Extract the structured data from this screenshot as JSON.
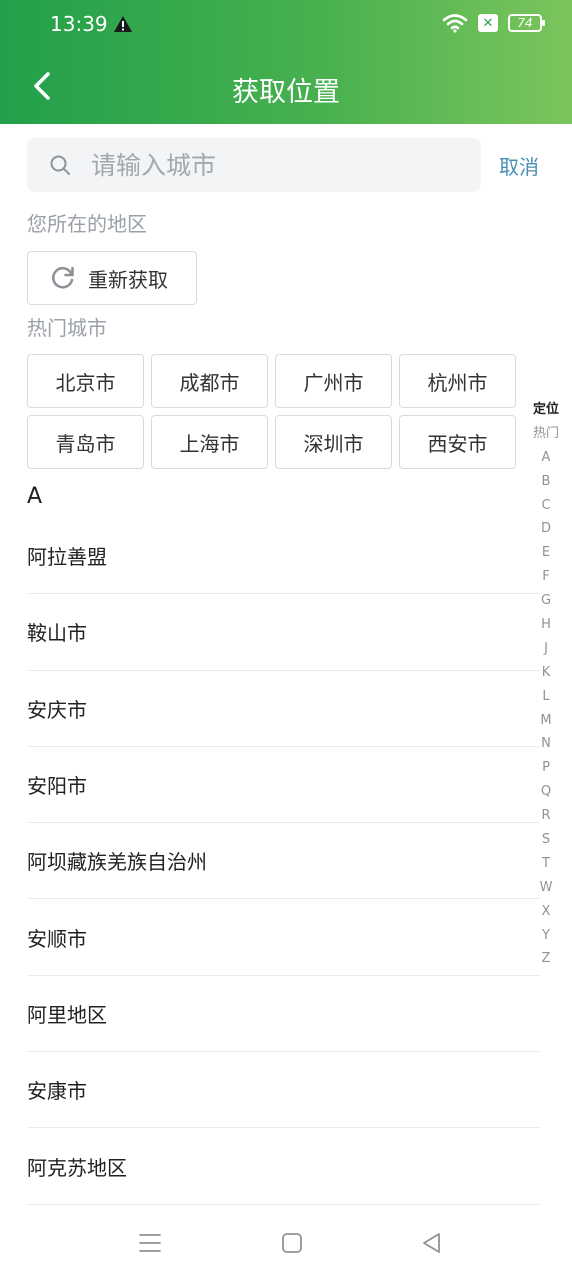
{
  "status_bar": {
    "time": "13:39",
    "battery": "74"
  },
  "header": {
    "title": "获取位置"
  },
  "search": {
    "placeholder": "请输入城市",
    "value": "",
    "cancel_label": "取消"
  },
  "location": {
    "section_label": "您所在的地区",
    "relocate_label": "重新获取"
  },
  "hot": {
    "section_label": "热门城市",
    "cities": [
      "北京市",
      "成都市",
      "广州市",
      "杭州市",
      "青岛市",
      "上海市",
      "深圳市",
      "西安市"
    ]
  },
  "list": {
    "letter": "A",
    "cities": [
      "阿拉善盟",
      "鞍山市",
      "安庆市",
      "安阳市",
      "阿坝藏族羌族自治州",
      "安顺市",
      "阿里地区",
      "安康市",
      "阿克苏地区"
    ]
  },
  "index_bar": [
    "定位",
    "热门",
    "A",
    "B",
    "C",
    "D",
    "E",
    "F",
    "G",
    "H",
    "J",
    "K",
    "L",
    "M",
    "N",
    "P",
    "Q",
    "R",
    "S",
    "T",
    "W",
    "X",
    "Y",
    "Z"
  ],
  "colors": {
    "header_start": "#22a04a",
    "header_end": "#7cc55c",
    "cancel": "#4a8fb5"
  }
}
